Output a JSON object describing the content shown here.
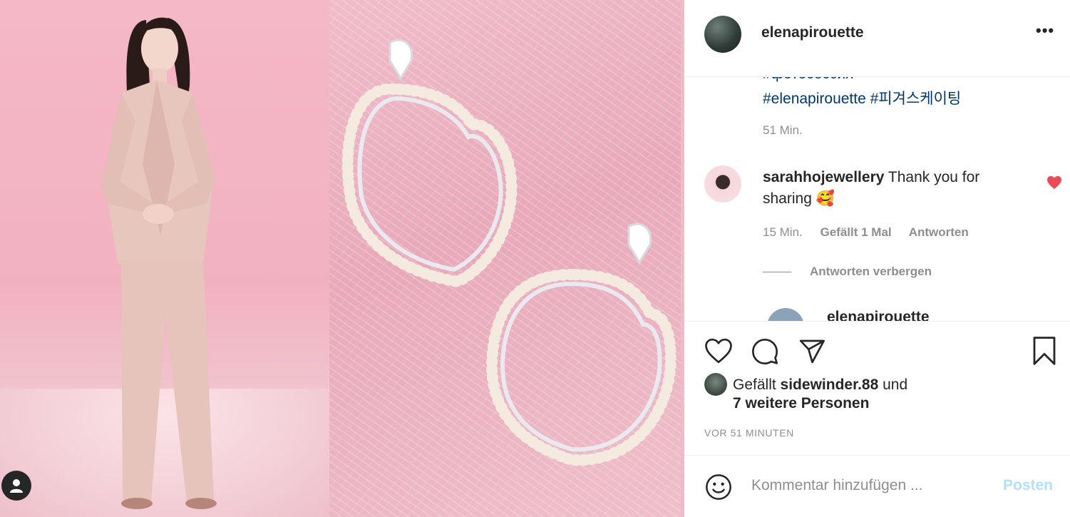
{
  "post": {
    "username": "elenapirouette",
    "more_label": "•••"
  },
  "caption": {
    "cut_off_text": "#фотосессия",
    "hashtags": "#elenapirouette #피겨스케이팅",
    "time": "51 Min."
  },
  "comment": {
    "username": "sarahhojewellery",
    "text": "Thank you for sharing 🥰",
    "time": "15 Min.",
    "likes": "Gefällt 1 Mal",
    "reply": "Antworten",
    "hide_replies": "Antworten verbergen",
    "next_username": "elenapirouette"
  },
  "likes": {
    "prefix": "Gefällt",
    "user": "sidewinder.88",
    "suffix": "und",
    "others": "7 weitere Personen"
  },
  "timestamp": "VOR 51 MINUTEN",
  "add_comment": {
    "placeholder": "Kommentar hinzufügen ...",
    "post_label": "Posten"
  },
  "icons": [
    "heart-icon",
    "comment-icon",
    "share-icon",
    "bookmark-icon",
    "emoji-icon",
    "user-tag-icon",
    "more-icon"
  ],
  "colors": {
    "link": "#00376b",
    "muted": "#8e8e8e",
    "like_red": "#ed4956",
    "post_disabled": "#b2dffc",
    "photo_pink": "#f2b1c1"
  }
}
